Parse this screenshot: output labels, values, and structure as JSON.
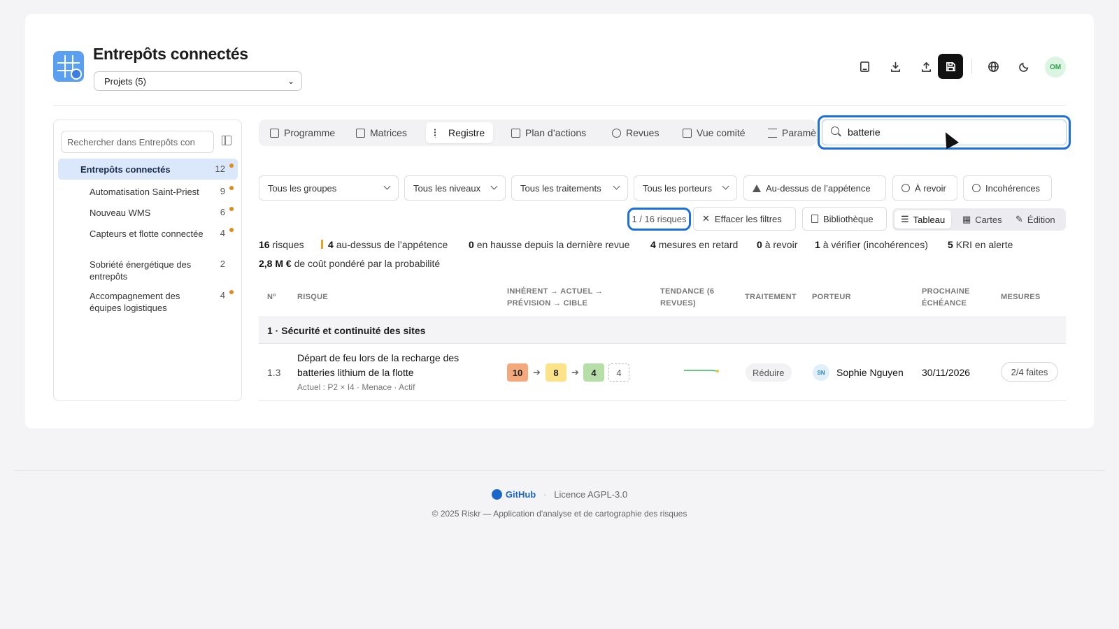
{
  "header": {
    "title": "Entrepôts connectés",
    "project_select": "Projets (5)",
    "toolbar": [
      "book-icon",
      "download-icon",
      "upload-icon",
      "save-icon",
      "globe-icon",
      "moon-icon"
    ],
    "avatar": "OM"
  },
  "sidebar": {
    "search_placeholder": "Rechercher dans Entrepôts con",
    "root": {
      "label": "Entrepôts connectés",
      "count": "12"
    },
    "items": [
      {
        "label": "Automatisation Saint-Priest",
        "count": "9"
      },
      {
        "label": "Nouveau WMS",
        "count": "6"
      },
      {
        "label": "Capteurs et flotte connectée",
        "count": "4"
      },
      {
        "label": "Sobriété énergétique des entrepôts",
        "count": "2"
      },
      {
        "label": "Accompagnement des équipes logistiques",
        "count": "4"
      }
    ]
  },
  "tabs": [
    "Programme",
    "Matrices",
    "Registre",
    "Plan d’actions",
    "Revues",
    "Vue comité",
    "Paramè"
  ],
  "search": {
    "value": "batterie"
  },
  "filters": [
    "Tous les groupes",
    "Tous les niveaux",
    "Tous les traitements",
    "Tous les porteurs",
    "Au-dessus de l’appétence",
    "À revoir",
    "Incohérences"
  ],
  "count_label": "1 / 16 risques",
  "clear_label": "Effacer les filtres",
  "library_label": "Bibliothèque",
  "views": [
    "Tableau",
    "Cartes",
    "Édition"
  ],
  "stats": {
    "risks_n": "16",
    "risks_t": "risques",
    "above_n": "4",
    "above_t": "au-dessus de l’appétence",
    "rising_n": "0",
    "rising_t": "en hausse depuis la dernière revue",
    "late_n": "4",
    "late_t": "mesures en retard",
    "review_n": "0",
    "review_t": "à revoir",
    "check_n": "1",
    "check_t": "à vérifier (incohérences)",
    "kri_n": "5",
    "kri_t": "KRI en alerte",
    "cost_n": "2,8 M €",
    "cost_t": "de coût pondéré par la probabilité"
  },
  "table": {
    "headers": {
      "num": "Nº",
      "risk": "Risque",
      "levels": "Inhérent → Actuel → Prévision → Cible",
      "trend": "Tendance (6 revues)",
      "treatment": "Traitement",
      "owner": "Porteur",
      "due": "Prochaine échéance",
      "measures": "Mesures"
    },
    "group": "1 · Sécurité et continuité des sites",
    "row": {
      "num": "1.3",
      "title": "Départ de feu lors de la recharge des batteries lithium de la flotte",
      "subtitle": "Actuel : P2 × I4 · Menace · Actif",
      "scores": [
        "10",
        "8",
        "4",
        "4"
      ],
      "treatment": "Réduire",
      "owner_initials": "SN",
      "owner": "Sophie Nguyen",
      "due": "30/11/2026",
      "measures": "2/4 faites"
    }
  },
  "footer": {
    "github": "GitHub",
    "dot": "·",
    "license": "Licence AGPL-3.0",
    "copyright": "© 2025 Riskr — Application d'analyse et de cartographie des risques"
  },
  "colors": {
    "accent": "#1a6fdc",
    "score_high": "#f4a97c",
    "score_mid": "#fce38a",
    "score_low": "#b6dfa8"
  }
}
